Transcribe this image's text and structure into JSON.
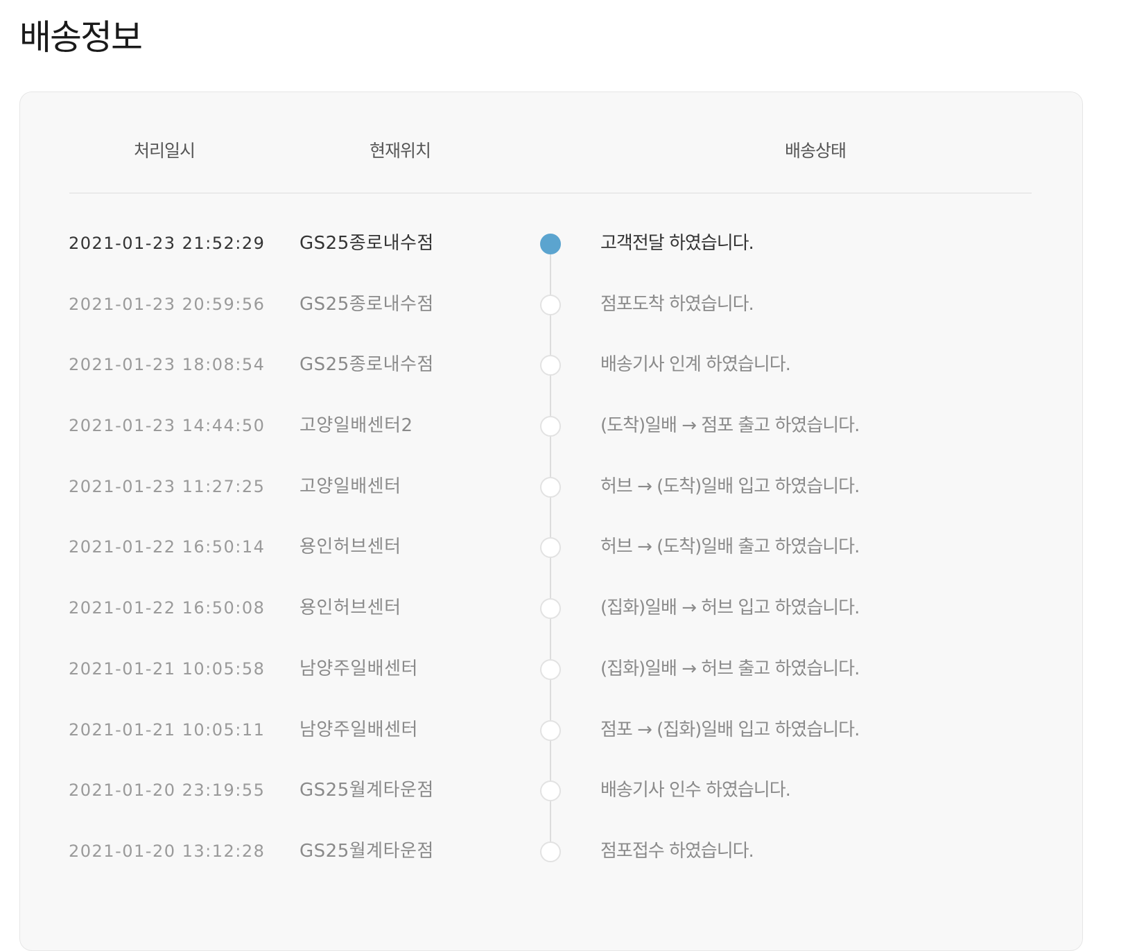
{
  "page_title": "배송정보",
  "colors": {
    "active_dot": "#5ba4cf",
    "inactive_dot_border": "#e2e2e2",
    "panel_bg": "#f8f8f8"
  },
  "table": {
    "headers": {
      "time": "처리일시",
      "location": "현재위치",
      "status": "배송상태"
    },
    "rows": [
      {
        "time": "2021-01-23 21:52:29",
        "location": "GS25종로내수점",
        "status": "고객전달 하였습니다.",
        "active": true
      },
      {
        "time": "2021-01-23 20:59:56",
        "location": "GS25종로내수점",
        "status": "점포도착 하였습니다.",
        "active": false
      },
      {
        "time": "2021-01-23 18:08:54",
        "location": "GS25종로내수점",
        "status": "배송기사 인계 하였습니다.",
        "active": false
      },
      {
        "time": "2021-01-23 14:44:50",
        "location": "고양일배센터2",
        "status": "(도착)일배 → 점포 출고 하였습니다.",
        "active": false
      },
      {
        "time": "2021-01-23 11:27:25",
        "location": "고양일배센터",
        "status": "허브 → (도착)일배 입고 하였습니다.",
        "active": false
      },
      {
        "time": "2021-01-22 16:50:14",
        "location": "용인허브센터",
        "status": "허브 → (도착)일배 출고 하였습니다.",
        "active": false
      },
      {
        "time": "2021-01-22 16:50:08",
        "location": "용인허브센터",
        "status": "(집화)일배 → 허브 입고 하였습니다.",
        "active": false
      },
      {
        "time": "2021-01-21 10:05:58",
        "location": "남양주일배센터",
        "status": "(집화)일배 → 허브 출고 하였습니다.",
        "active": false
      },
      {
        "time": "2021-01-21 10:05:11",
        "location": "남양주일배센터",
        "status": "점포 → (집화)일배 입고 하였습니다.",
        "active": false
      },
      {
        "time": "2021-01-20 23:19:55",
        "location": "GS25월계타운점",
        "status": "배송기사 인수 하였습니다.",
        "active": false
      },
      {
        "time": "2021-01-20 13:12:28",
        "location": "GS25월계타운점",
        "status": "점포접수 하였습니다.",
        "active": false
      }
    ]
  }
}
